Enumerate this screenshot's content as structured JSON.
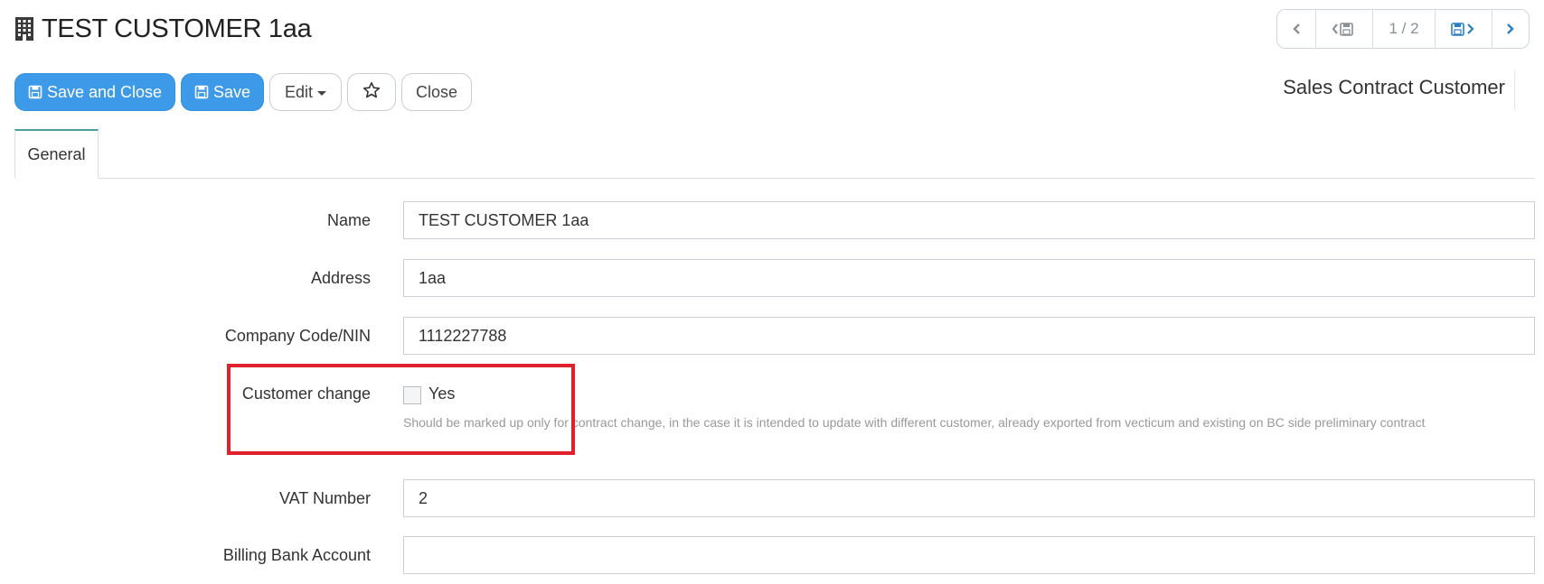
{
  "header": {
    "title": "TEST CUSTOMER 1aa",
    "title_icon": "building-icon"
  },
  "pager": {
    "count": "1 / 2",
    "icons": [
      "chevron-left-icon",
      "chevron-left-save-icon",
      "save-chevron-right-icon",
      "chevron-right-icon"
    ]
  },
  "toolbar": {
    "save_close_label": "Save and Close",
    "save_label": "Save",
    "edit_label": "Edit",
    "close_label": "Close",
    "favorite_icon": "star-icon"
  },
  "form_type": "Sales Contract Customer",
  "tabs": [
    {
      "label": "General",
      "active": true
    }
  ],
  "form": {
    "name": {
      "label": "Name",
      "value": "TEST CUSTOMER 1aa"
    },
    "address": {
      "label": "Address",
      "value": "1aa"
    },
    "company_code": {
      "label": "Company Code/NIN",
      "value": "1112227788"
    },
    "customer_change": {
      "label": "Customer change",
      "option_label": "Yes",
      "checked": false,
      "help": "Should be marked up only for contract change, in the case it is intended to update with different customer, already exported from vecticum and existing on BC side preliminary contract"
    },
    "vat_number": {
      "label": "VAT Number",
      "value": "2"
    },
    "billing_bank_account": {
      "label": "Billing Bank Account",
      "value": ""
    }
  },
  "colors": {
    "primary": "#3d9ae8",
    "link": "#2a7fbf",
    "highlight": "#e0202a",
    "tab_accent": "#4aa0a6"
  }
}
